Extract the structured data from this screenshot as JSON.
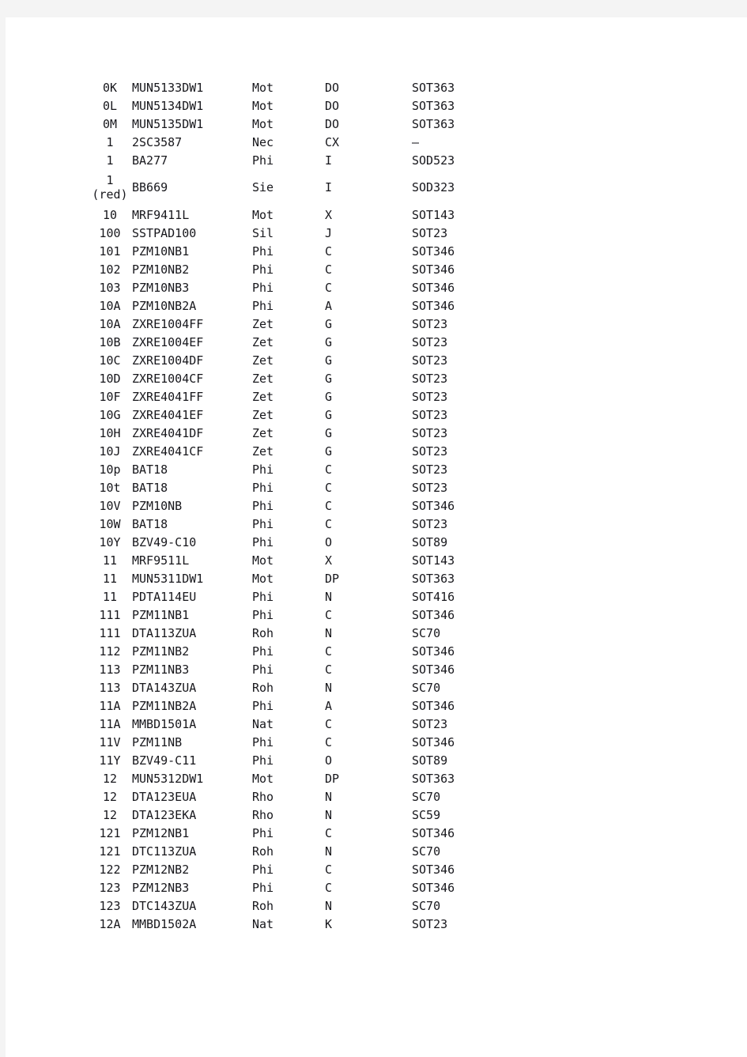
{
  "page": {
    "background_color": "#f4f4f4",
    "sheet_color": "#ffffff",
    "text_color": "#17171c"
  },
  "table": {
    "name": "smd-marking-code-table",
    "columns": [
      "code",
      "part_number",
      "manufacturer",
      "package_code",
      "case_style"
    ],
    "rows": [
      {
        "code": "0K",
        "code_note": "",
        "part_number": "MUN5133DW1",
        "manufacturer": "Mot",
        "package_code": "DO",
        "case_style": "SOT363"
      },
      {
        "code": "0L",
        "code_note": "",
        "part_number": "MUN5134DW1",
        "manufacturer": "Mot",
        "package_code": "DO",
        "case_style": "SOT363"
      },
      {
        "code": "0M",
        "code_note": "",
        "part_number": "MUN5135DW1",
        "manufacturer": "Mot",
        "package_code": "DO",
        "case_style": "SOT363"
      },
      {
        "code": "1",
        "code_note": "",
        "part_number": "2SC3587",
        "manufacturer": "Nec",
        "package_code": "CX",
        "case_style": "–"
      },
      {
        "code": "1",
        "code_note": "",
        "part_number": "BA277",
        "manufacturer": "Phi",
        "package_code": "I",
        "case_style": "SOD523"
      },
      {
        "code": "1",
        "code_note": "(red)",
        "part_number": "BB669",
        "manufacturer": "Sie",
        "package_code": "I",
        "case_style": "SOD323"
      },
      {
        "code": "10",
        "code_note": "",
        "part_number": "MRF9411L",
        "manufacturer": "Mot",
        "package_code": "X",
        "case_style": "SOT143"
      },
      {
        "code": "100",
        "code_note": "",
        "part_number": "SSTPAD100",
        "manufacturer": "Sil",
        "package_code": "J",
        "case_style": "SOT23"
      },
      {
        "code": "101",
        "code_note": "",
        "part_number": "PZM10NB1",
        "manufacturer": "Phi",
        "package_code": "C",
        "case_style": "SOT346"
      },
      {
        "code": "102",
        "code_note": "",
        "part_number": "PZM10NB2",
        "manufacturer": "Phi",
        "package_code": "C",
        "case_style": "SOT346"
      },
      {
        "code": "103",
        "code_note": "",
        "part_number": "PZM10NB3",
        "manufacturer": "Phi",
        "package_code": "C",
        "case_style": "SOT346"
      },
      {
        "code": "10A",
        "code_note": "",
        "part_number": "PZM10NB2A",
        "manufacturer": "Phi",
        "package_code": "A",
        "case_style": "SOT346"
      },
      {
        "code": "10A",
        "code_note": "",
        "part_number": "ZXRE1004FF",
        "manufacturer": "Zet",
        "package_code": "G",
        "case_style": "SOT23"
      },
      {
        "code": "10B",
        "code_note": "",
        "part_number": "ZXRE1004EF",
        "manufacturer": "Zet",
        "package_code": "G",
        "case_style": "SOT23"
      },
      {
        "code": "10C",
        "code_note": "",
        "part_number": "ZXRE1004DF",
        "manufacturer": "Zet",
        "package_code": "G",
        "case_style": "SOT23"
      },
      {
        "code": "10D",
        "code_note": "",
        "part_number": "ZXRE1004CF",
        "manufacturer": "Zet",
        "package_code": "G",
        "case_style": "SOT23"
      },
      {
        "code": "10F",
        "code_note": "",
        "part_number": "ZXRE4041FF",
        "manufacturer": "Zet",
        "package_code": "G",
        "case_style": "SOT23"
      },
      {
        "code": "10G",
        "code_note": "",
        "part_number": "ZXRE4041EF",
        "manufacturer": "Zet",
        "package_code": "G",
        "case_style": "SOT23"
      },
      {
        "code": "10H",
        "code_note": "",
        "part_number": "ZXRE4041DF",
        "manufacturer": "Zet",
        "package_code": "G",
        "case_style": "SOT23"
      },
      {
        "code": "10J",
        "code_note": "",
        "part_number": "ZXRE4041CF",
        "manufacturer": "Zet",
        "package_code": "G",
        "case_style": "SOT23"
      },
      {
        "code": "10p",
        "code_note": "",
        "part_number": "BAT18",
        "manufacturer": "Phi",
        "package_code": "C",
        "case_style": "SOT23"
      },
      {
        "code": "10t",
        "code_note": "",
        "part_number": "BAT18",
        "manufacturer": "Phi",
        "package_code": "C",
        "case_style": "SOT23"
      },
      {
        "code": "10V",
        "code_note": "",
        "part_number": "PZM10NB",
        "manufacturer": "Phi",
        "package_code": "C",
        "case_style": "SOT346"
      },
      {
        "code": "10W",
        "code_note": "",
        "part_number": "BAT18",
        "manufacturer": "Phi",
        "package_code": "C",
        "case_style": "SOT23"
      },
      {
        "code": "10Y",
        "code_note": "",
        "part_number": "BZV49-C10",
        "manufacturer": "Phi",
        "package_code": "O",
        "case_style": "SOT89"
      },
      {
        "code": "11",
        "code_note": "",
        "part_number": "MRF9511L",
        "manufacturer": "Mot",
        "package_code": "X",
        "case_style": "SOT143"
      },
      {
        "code": "11",
        "code_note": "",
        "part_number": "MUN5311DW1",
        "manufacturer": "Mot",
        "package_code": "DP",
        "case_style": "SOT363"
      },
      {
        "code": "11",
        "code_note": "",
        "part_number": "PDTA114EU",
        "manufacturer": "Phi",
        "package_code": "N",
        "case_style": "SOT416"
      },
      {
        "code": "111",
        "code_note": "",
        "part_number": "PZM11NB1",
        "manufacturer": "Phi",
        "package_code": "C",
        "case_style": "SOT346"
      },
      {
        "code": "111",
        "code_note": "",
        "part_number": "DTA113ZUA",
        "manufacturer": "Roh",
        "package_code": "N",
        "case_style": "SC70"
      },
      {
        "code": "112",
        "code_note": "",
        "part_number": "PZM11NB2",
        "manufacturer": "Phi",
        "package_code": "C",
        "case_style": "SOT346"
      },
      {
        "code": "113",
        "code_note": "",
        "part_number": "PZM11NB3",
        "manufacturer": "Phi",
        "package_code": "C",
        "case_style": "SOT346"
      },
      {
        "code": "113",
        "code_note": "",
        "part_number": "DTA143ZUA",
        "manufacturer": "Roh",
        "package_code": "N",
        "case_style": "SC70"
      },
      {
        "code": "11A",
        "code_note": "",
        "part_number": "PZM11NB2A",
        "manufacturer": "Phi",
        "package_code": "A",
        "case_style": "SOT346"
      },
      {
        "code": "11A",
        "code_note": "",
        "part_number": "MMBD1501A",
        "manufacturer": "Nat",
        "package_code": "C",
        "case_style": "SOT23"
      },
      {
        "code": "11V",
        "code_note": "",
        "part_number": "PZM11NB",
        "manufacturer": "Phi",
        "package_code": "C",
        "case_style": "SOT346"
      },
      {
        "code": "11Y",
        "code_note": "",
        "part_number": "BZV49-C11",
        "manufacturer": "Phi",
        "package_code": "O",
        "case_style": "SOT89"
      },
      {
        "code": "12",
        "code_note": "",
        "part_number": "MUN5312DW1",
        "manufacturer": "Mot",
        "package_code": "DP",
        "case_style": "SOT363"
      },
      {
        "code": "12",
        "code_note": "",
        "part_number": "DTA123EUA",
        "manufacturer": "Rho",
        "package_code": "N",
        "case_style": "SC70"
      },
      {
        "code": "12",
        "code_note": "",
        "part_number": "DTA123EKA",
        "manufacturer": "Rho",
        "package_code": "N",
        "case_style": "SC59"
      },
      {
        "code": "121",
        "code_note": "",
        "part_number": "PZM12NB1",
        "manufacturer": "Phi",
        "package_code": "C",
        "case_style": "SOT346"
      },
      {
        "code": "121",
        "code_note": "",
        "part_number": "DTC113ZUA",
        "manufacturer": "Roh",
        "package_code": "N",
        "case_style": "SC70"
      },
      {
        "code": "122",
        "code_note": "",
        "part_number": "PZM12NB2",
        "manufacturer": "Phi",
        "package_code": "C",
        "case_style": "SOT346"
      },
      {
        "code": "123",
        "code_note": "",
        "part_number": "PZM12NB3",
        "manufacturer": "Phi",
        "package_code": "C",
        "case_style": "SOT346"
      },
      {
        "code": "123",
        "code_note": "",
        "part_number": "DTC143ZUA",
        "manufacturer": "Roh",
        "package_code": "N",
        "case_style": "SC70"
      },
      {
        "code": "12A",
        "code_note": "",
        "part_number": "MMBD1502A",
        "manufacturer": "Nat",
        "package_code": "K",
        "case_style": "SOT23"
      }
    ]
  }
}
